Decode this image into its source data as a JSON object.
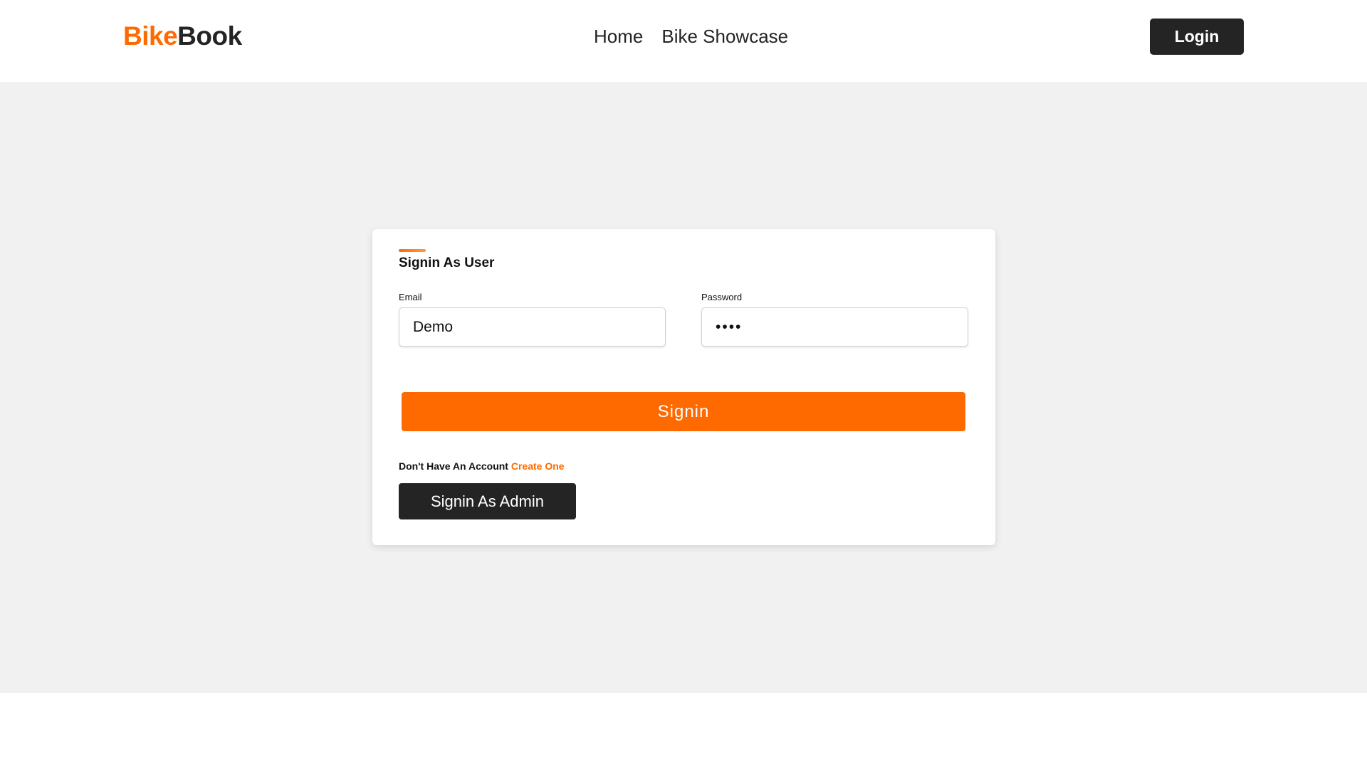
{
  "header": {
    "brand_accent": "Bike",
    "brand_main": "Book",
    "nav": [
      {
        "label": "Home"
      },
      {
        "label": "Bike Showcase"
      }
    ],
    "login_label": "Login"
  },
  "form": {
    "title": "Signin As User",
    "email_label": "Email",
    "email_value": "Demo",
    "password_label": "Password",
    "password_value": "demo",
    "signin_label": "Signin",
    "no_account_text": "Don't Have An Account",
    "create_link_label": "Create One",
    "admin_button_label": "Signin As Admin"
  },
  "colors": {
    "accent": "#ff6a00",
    "dark": "#242424",
    "page_bg": "#f1f1f1"
  }
}
